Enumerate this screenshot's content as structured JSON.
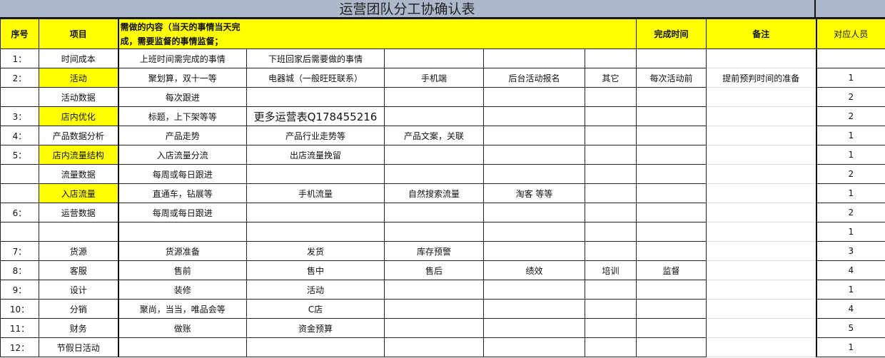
{
  "title": "运营团队分工协确认表",
  "headers": {
    "seq": "序号",
    "item": "项目",
    "content": "需做的内容（当天的事情当天完成，需要监督的事情监督；",
    "finish_time": "完成时间",
    "remark": "备注",
    "staff": "对应人员"
  },
  "rows": [
    {
      "seq": "1：",
      "item": "时间成本",
      "c1": "上班时间需完成的事情",
      "c2": "下班回家后需要做的事情",
      "c3": "",
      "c4": "",
      "c5": "",
      "time": "",
      "remark": "",
      "staff": "",
      "yellow": false
    },
    {
      "seq": "2：",
      "item": "活动",
      "c1": "聚划算，双十一等",
      "c2": "电器城（一般旺旺联系）",
      "c3": "手机端",
      "c4": "后台活动报名",
      "c5": "其它",
      "time": "每次活动前",
      "remark": "提前预判时间的准备",
      "staff": "1",
      "yellow": true
    },
    {
      "seq": "",
      "item": "活动数据",
      "c1": "每次跟进",
      "c2": "",
      "c3": "",
      "c4": "",
      "c5": "",
      "time": "",
      "remark": "",
      "staff": "2",
      "yellow": false
    },
    {
      "seq": "3：",
      "item": "店内优化",
      "c1": "标题，上下架等等",
      "c2": "更多运营表Q178455216",
      "c3": "",
      "c4": "",
      "c5": "",
      "time": "",
      "remark": "",
      "staff": "2",
      "yellow": true
    },
    {
      "seq": "4：",
      "item": "产品数据分析",
      "c1": "产品走势",
      "c2": "产品行业走势等",
      "c3": "产品文案，关联",
      "c4": "",
      "c5": "",
      "time": "",
      "remark": "",
      "staff": "1",
      "yellow": false
    },
    {
      "seq": "5：",
      "item": "店内流量结构",
      "c1": "入店流量分流",
      "c2": "出店流量挽留",
      "c3": "",
      "c4": "",
      "c5": "",
      "time": "",
      "remark": "",
      "staff": "1",
      "yellow": true
    },
    {
      "seq": "",
      "item": "流量数据",
      "c1": "每周或每日跟进",
      "c2": "",
      "c3": "",
      "c4": "",
      "c5": "",
      "time": "",
      "remark": "",
      "staff": "2",
      "yellow": false
    },
    {
      "seq": "",
      "item": "入店流量",
      "c1": "直通车，钻展等",
      "c2": "手机流量",
      "c3": "自然搜索流量",
      "c4": "淘客 等等",
      "c5": "",
      "time": "",
      "remark": "",
      "staff": "1",
      "yellow": true
    },
    {
      "seq": "6：",
      "item": "运营数据",
      "c1": "每周或每日跟进",
      "c2": "",
      "c3": "",
      "c4": "",
      "c5": "",
      "time": "",
      "remark": "",
      "staff": "2",
      "yellow": false
    },
    {
      "seq": "",
      "item": "",
      "c1": "",
      "c2": "",
      "c3": "",
      "c4": "",
      "c5": "",
      "time": "",
      "remark": "",
      "staff": "1",
      "yellow": false
    },
    {
      "seq": "7：",
      "item": "货源",
      "c1": "货源准备",
      "c2": "发货",
      "c3": "库存预警",
      "c4": "",
      "c5": "",
      "time": "",
      "remark": "",
      "staff": "3",
      "yellow": false
    },
    {
      "seq": "8：",
      "item": "客服",
      "c1": "售前",
      "c2": "售中",
      "c3": "售后",
      "c4": "绩效",
      "c5": "培训",
      "time": "监督",
      "remark": "",
      "staff": "4",
      "yellow": false
    },
    {
      "seq": "9：",
      "item": "设计",
      "c1": "装修",
      "c2": "活动",
      "c3": "",
      "c4": "",
      "c5": "",
      "time": "",
      "remark": "",
      "staff": "1",
      "yellow": false
    },
    {
      "seq": "10：",
      "item": "分销",
      "c1": "聚尚，当当，唯品会等",
      "c2": "C店",
      "c3": "",
      "c4": "",
      "c5": "",
      "time": "",
      "remark": "",
      "staff": "4",
      "yellow": false
    },
    {
      "seq": "11：",
      "item": "财务",
      "c1": "做账",
      "c2": "资金预算",
      "c3": "",
      "c4": "",
      "c5": "",
      "time": "",
      "remark": "",
      "staff": "5",
      "yellow": false
    },
    {
      "seq": "12：",
      "item": "节假日活动",
      "c1": "",
      "c2": "",
      "c3": "",
      "c4": "",
      "c5": "",
      "time": "",
      "remark": "",
      "staff": "1",
      "yellow": false
    }
  ]
}
